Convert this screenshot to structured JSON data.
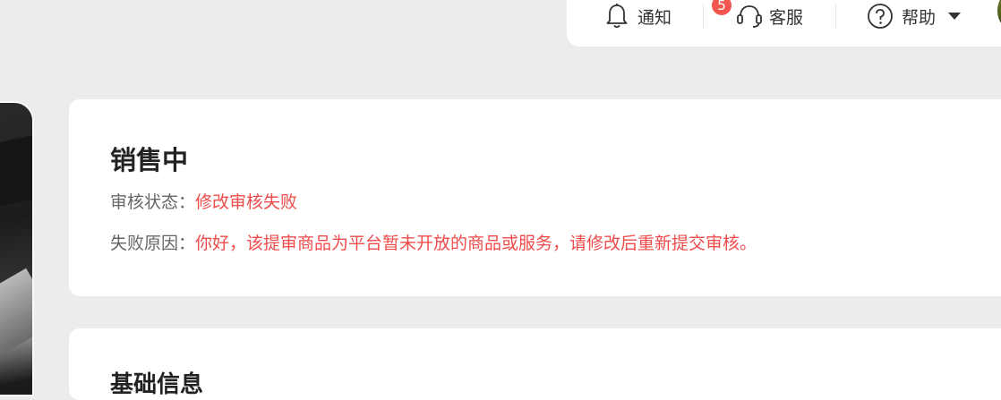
{
  "header": {
    "notifications": {
      "label": "通知",
      "badge": "5"
    },
    "support": {
      "label": "客服"
    },
    "help": {
      "label": "帮助"
    }
  },
  "status_card": {
    "title": "销售中",
    "review_status_label": "审核状态：",
    "review_status_value": "修改审核失败",
    "failure_reason_label": "失败原因：",
    "failure_reason_value": "你好，该提审商品为平台暂未开放的商品或服务，请修改后重新提交审核。"
  },
  "info_card": {
    "title": "基础信息"
  },
  "colors": {
    "error_text": "#ef4b4b",
    "badge": "#f2564f",
    "page_background": "#ececec"
  },
  "icons": {
    "notifications": "bell-icon",
    "support": "headset-icon",
    "help": "question-circle-icon",
    "help_dropdown": "caret-down-icon"
  }
}
